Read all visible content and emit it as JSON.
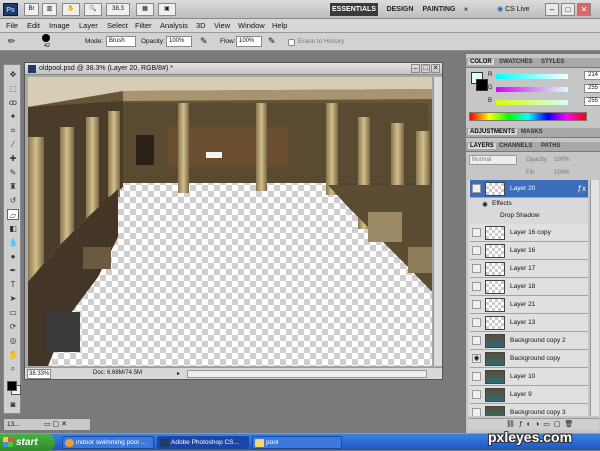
{
  "titlebar": {
    "logo": "Ps",
    "zoom": "38.3",
    "workspaces": [
      "ESSENTIALS",
      "DESIGN",
      "PAINTING"
    ],
    "active_workspace": "ESSENTIALS",
    "more": "»",
    "cs_live": "CS Live",
    "window_controls": [
      "–",
      "□",
      "✕"
    ]
  },
  "menu": [
    "File",
    "Edit",
    "Image",
    "Layer",
    "Select",
    "Filter",
    "Analysis",
    "3D",
    "View",
    "Window",
    "Help"
  ],
  "options": {
    "brush_size": "42",
    "mode_label": "Mode:",
    "mode_value": "Brush",
    "opacity_label": "Opacity:",
    "opacity_value": "100%",
    "flow_label": "Flow:",
    "flow_value": "100%",
    "erase_to_history": "Erase to History"
  },
  "document": {
    "title": "oldpool.psd @ 38.3% (Layer 20, RGB/8#) *",
    "zoom": "38.33%",
    "doc_size": "Doc: 6.68M/74.5M",
    "background_image": "roman-bath-colonnade-photo"
  },
  "color_panel": {
    "tabs": [
      "COLOR",
      "SWATCHES",
      "STYLES"
    ],
    "r_label": "R",
    "g_label": "G",
    "b_label": "B",
    "r": "214",
    "g": "255",
    "b": "255"
  },
  "adjustments_panel": {
    "tabs": [
      "ADJUSTMENTS",
      "MASKS"
    ]
  },
  "layers_panel": {
    "tabs": [
      "LAYERS",
      "CHANNELS",
      "PATHS"
    ],
    "blend_mode": "Normal",
    "opacity_label": "Opacity:",
    "opacity_value": "100%",
    "fill_label": "Fill:",
    "fill_value": "100%",
    "selected_layer": "Layer 20",
    "effects_label": "Effects",
    "effect_name": "Drop Shadow",
    "layers": [
      "Layer 16 copy",
      "Layer 16",
      "Layer 17",
      "Layer 18",
      "Layer 21",
      "Layer 13",
      "Background copy 2",
      "Background copy",
      "Layer 10",
      "Layer 9",
      "Background copy 3"
    ]
  },
  "taskbar": {
    "start": "start",
    "items": [
      "indoor swimming pool ...",
      "Adobe Photoshop CS...",
      "pool"
    ],
    "minimized_doc": "13..."
  },
  "watermark": "pxleyes.com",
  "colors": {
    "selected_row": "#3b6dbb",
    "taskbar": "#1d55c8",
    "start": "#2f8c2b",
    "fg_color": "#000000",
    "bg_color": "#e6fafc"
  }
}
